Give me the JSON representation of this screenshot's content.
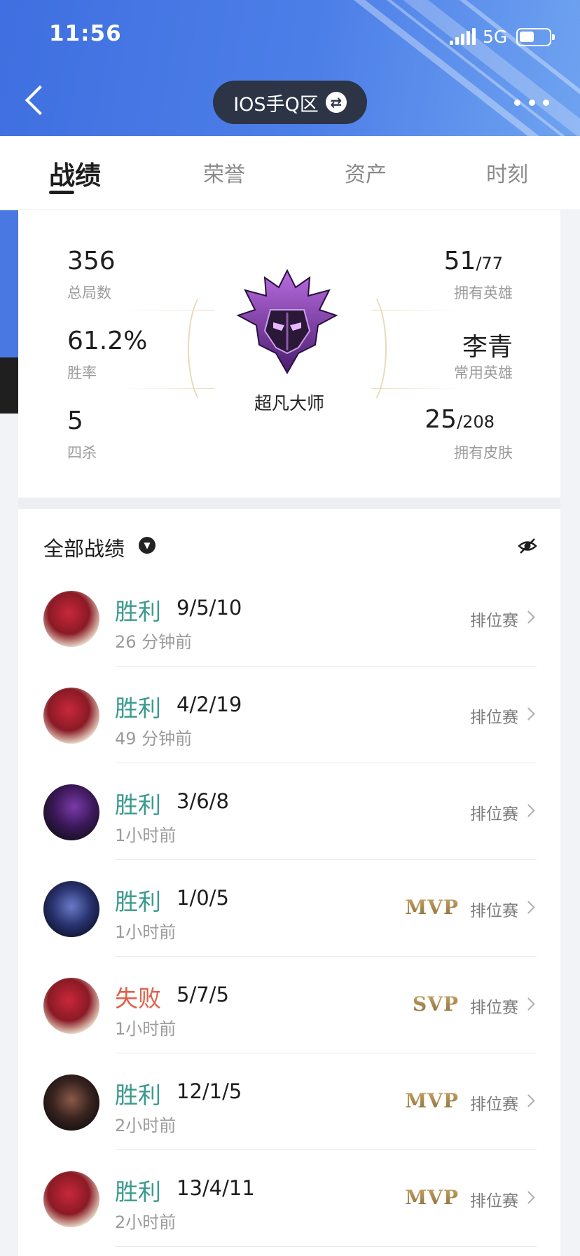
{
  "status_bar": {
    "time": "11:56",
    "network": "5G"
  },
  "header": {
    "region": "IOS手Q区"
  },
  "tabs": [
    {
      "label": "战绩",
      "active": true
    },
    {
      "label": "荣誉",
      "active": false
    },
    {
      "label": "资产",
      "active": false
    },
    {
      "label": "时刻",
      "active": false
    }
  ],
  "overview": {
    "total_games": {
      "value": "356",
      "label": "总局数"
    },
    "win_rate": {
      "value": "61.2%",
      "label": "胜率"
    },
    "quadra_kills": {
      "value": "5",
      "label": "四杀"
    },
    "heroes_owned": {
      "value": "51",
      "total": "/77",
      "label": "拥有英雄"
    },
    "favorite_hero": {
      "value": "李青",
      "label": "常用英雄"
    },
    "skins_owned": {
      "value": "25",
      "total": "/208",
      "label": "拥有皮肤"
    },
    "rank": "超凡大师"
  },
  "records": {
    "title": "全部战绩",
    "items": [
      {
        "result": "胜利",
        "outcome": "win",
        "kda": "9/5/10",
        "time": "26 分钟前",
        "badge": "",
        "mode": "排位赛",
        "avatar": "red"
      },
      {
        "result": "胜利",
        "outcome": "win",
        "kda": "4/2/19",
        "time": "49 分钟前",
        "badge": "",
        "mode": "排位赛",
        "avatar": "red"
      },
      {
        "result": "胜利",
        "outcome": "win",
        "kda": "3/6/8",
        "time": "1小时前",
        "badge": "",
        "mode": "排位赛",
        "avatar": "purple"
      },
      {
        "result": "胜利",
        "outcome": "win",
        "kda": "1/0/5",
        "time": "1小时前",
        "badge": "MVP",
        "mode": "排位赛",
        "avatar": "blue"
      },
      {
        "result": "失败",
        "outcome": "loss",
        "kda": "5/7/5",
        "time": "1小时前",
        "badge": "SVP",
        "mode": "排位赛",
        "avatar": "red"
      },
      {
        "result": "胜利",
        "outcome": "win",
        "kda": "12/1/5",
        "time": "2小时前",
        "badge": "MVP",
        "mode": "排位赛",
        "avatar": "dark"
      },
      {
        "result": "胜利",
        "outcome": "win",
        "kda": "13/4/11",
        "time": "2小时前",
        "badge": "MVP",
        "mode": "排位赛",
        "avatar": "red"
      }
    ]
  },
  "colors": {
    "win": "#3a9a8e",
    "loss": "#e0604a",
    "header_blue": "#4a78e2"
  }
}
